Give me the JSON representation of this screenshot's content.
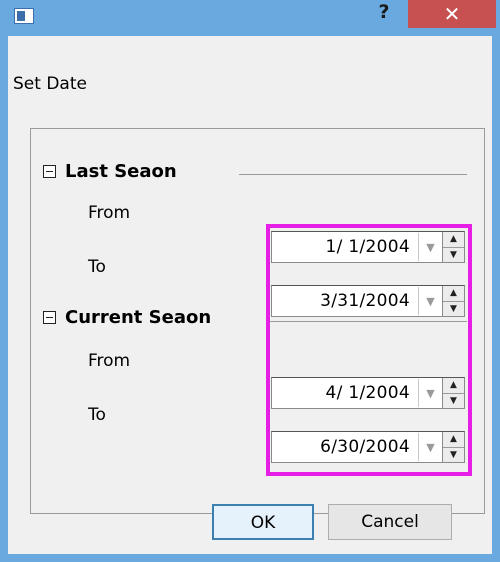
{
  "window": {
    "help_label": "?",
    "close_label": "✕",
    "icon": "app-window-icon"
  },
  "heading": "Set Date",
  "sections": [
    {
      "title": "Last Seaon",
      "toggle": "⊟",
      "rows": [
        {
          "label": "From",
          "value": "1/  1/2004"
        },
        {
          "label": "To",
          "value": "3/31/2004"
        }
      ]
    },
    {
      "title": "Current Seaon",
      "toggle": "⊟",
      "rows": [
        {
          "label": "From",
          "value": "4/  1/2004"
        },
        {
          "label": "To",
          "value": "6/30/2004"
        }
      ]
    }
  ],
  "icons": {
    "dropdown": "chevron-down-icon",
    "spin_up": "spin-up-icon",
    "spin_down": "spin-down-icon"
  },
  "highlight_color": "#e61ee6",
  "buttons": {
    "ok": "OK",
    "cancel": "Cancel"
  }
}
